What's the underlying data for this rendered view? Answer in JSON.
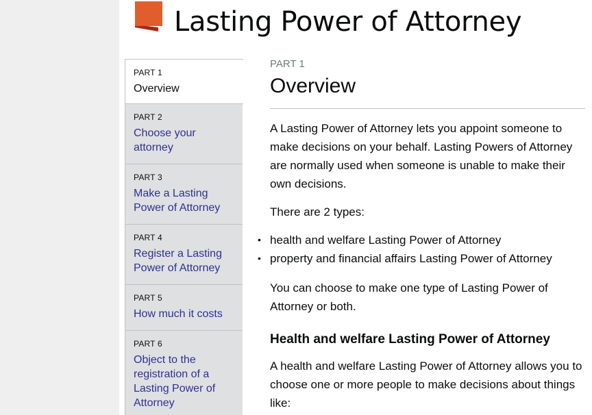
{
  "header": {
    "title": "Lasting Power of Attorney",
    "logo_color": "#e05d2c",
    "logo_shadow_color": "#b0231c"
  },
  "nav": {
    "items": [
      {
        "part": "PART 1",
        "label": "Overview",
        "current": true
      },
      {
        "part": "PART 2",
        "label": "Choose your attorney",
        "current": false
      },
      {
        "part": "PART 3",
        "label": "Make a Lasting Power of Attorney",
        "current": false
      },
      {
        "part": "PART 4",
        "label": "Register a Lasting Power of Attorney",
        "current": false
      },
      {
        "part": "PART 5",
        "label": "How much it costs",
        "current": false
      },
      {
        "part": "PART 6",
        "label": "Object to the registration of a Lasting Power of Attorney",
        "current": false
      }
    ],
    "link_color": "#2e3191"
  },
  "main": {
    "kicker": "PART 1",
    "title": "Overview",
    "intro": "A Lasting Power of Attorney lets you appoint someone to make decisions on your behalf. Lasting Powers of Attorney are normally used when someone is unable to make their own decisions.",
    "types_intro": "There are 2 types:",
    "types": [
      "health and welfare Lasting Power of Attorney",
      "property and financial affairs Lasting Power of Attorney"
    ],
    "choose_text": "You can choose to make one type of Lasting Power of Attorney or both.",
    "section_heading": "Health and welfare Lasting Power of Attorney",
    "section_text": "A health and welfare Lasting Power of Attorney allows you to choose one or more people to make decisions about things like:"
  }
}
